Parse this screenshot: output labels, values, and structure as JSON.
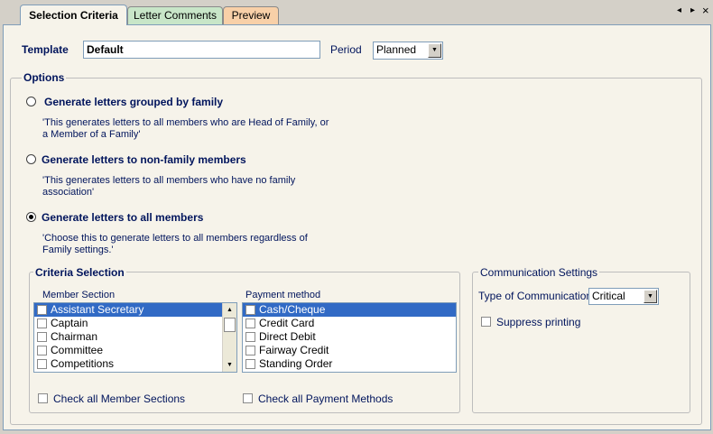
{
  "tabs": {
    "selection": "Selection Criteria",
    "comments": "Letter Comments",
    "preview": "Preview",
    "prev_arrow": "◂",
    "next_arrow": "▸",
    "close": "×"
  },
  "template": {
    "label": "Template",
    "value": "Default"
  },
  "period": {
    "label": "Period",
    "value": "Planned",
    "arrow": "▼"
  },
  "options": {
    "title": "Options",
    "radios": [
      {
        "label": "Generate letters grouped by family",
        "desc": "'This generates letters to all members who are Head of Family, or a Member of a Family'",
        "checked": false
      },
      {
        "label": "Generate letters to non-family members",
        "desc": "'This generates letters to all members who have no family association'",
        "checked": false
      },
      {
        "label": "Generate letters to all members",
        "desc": "'Choose this to generate letters to all members regardless of Family settings.'",
        "checked": true
      }
    ]
  },
  "criteria": {
    "title": "Criteria Selection",
    "member_section": {
      "label": "Member Section",
      "items": [
        "Assistant Secretary",
        "Captain",
        "Chairman",
        "Committee",
        "Competitions"
      ],
      "selected_index": 0,
      "scroll_up": "▲",
      "scroll_down": "▼"
    },
    "payment_method": {
      "label": "Payment method",
      "items": [
        "Cash/Cheque",
        "Credit Card",
        "Direct Debit",
        "Fairway Credit",
        "Standing Order"
      ],
      "selected_index": 0
    },
    "check_all_members": "Check all Member Sections",
    "check_all_payments": "Check all Payment Methods"
  },
  "communication": {
    "title": "Communication Settings",
    "type_label": "Type of Communication",
    "type_value": "Critical",
    "arrow": "▼",
    "suppress_label": "Suppress printing"
  }
}
